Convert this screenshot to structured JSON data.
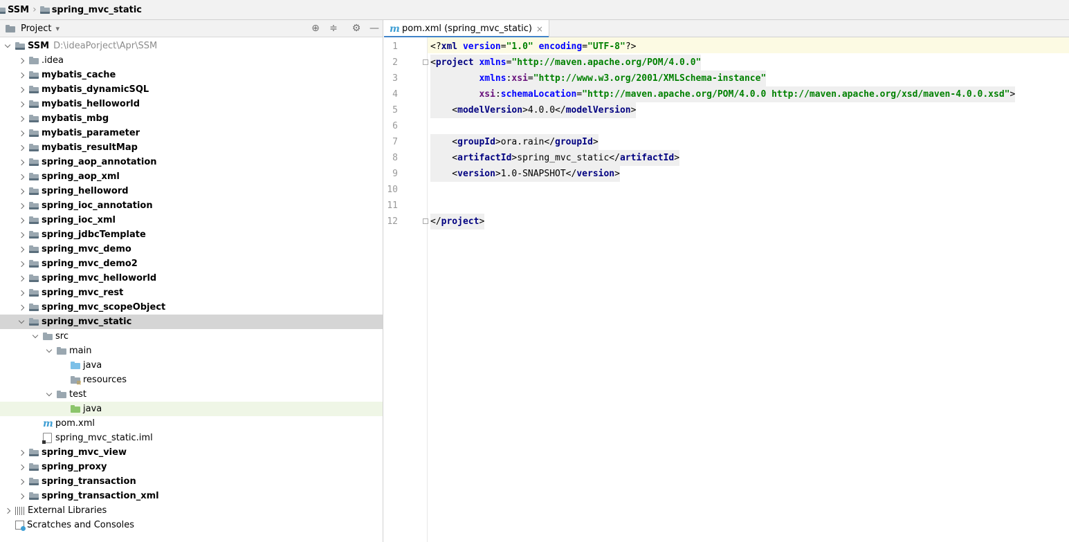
{
  "breadcrumb": {
    "root": "SSM",
    "current": "spring_mvc_static"
  },
  "project_panel": {
    "title": "Project",
    "tree": [
      {
        "label": "SSM",
        "hint": "D:\\ideaPorject\\Apr\\SSM",
        "depth": 0,
        "expanded": true,
        "bold": true,
        "icon": "module-folder-icon"
      },
      {
        "label": ".idea",
        "depth": 1,
        "expanded": false,
        "bold": false,
        "icon": "folder-icon"
      },
      {
        "label": "mybatis_cache",
        "depth": 1,
        "expanded": false,
        "bold": true,
        "icon": "module-folder-icon"
      },
      {
        "label": "mybatis_dynamicSQL",
        "depth": 1,
        "expanded": false,
        "bold": true,
        "icon": "module-folder-icon"
      },
      {
        "label": "mybatis_helloworld",
        "depth": 1,
        "expanded": false,
        "bold": true,
        "icon": "module-folder-icon"
      },
      {
        "label": "mybatis_mbg",
        "depth": 1,
        "expanded": false,
        "bold": true,
        "icon": "module-folder-icon"
      },
      {
        "label": "mybatis_parameter",
        "depth": 1,
        "expanded": false,
        "bold": true,
        "icon": "module-folder-icon"
      },
      {
        "label": "mybatis_resultMap",
        "depth": 1,
        "expanded": false,
        "bold": true,
        "icon": "module-folder-icon"
      },
      {
        "label": "spring_aop_annotation",
        "depth": 1,
        "expanded": false,
        "bold": true,
        "icon": "module-folder-icon"
      },
      {
        "label": "spring_aop_xml",
        "depth": 1,
        "expanded": false,
        "bold": true,
        "icon": "module-folder-icon"
      },
      {
        "label": "spring_helloword",
        "depth": 1,
        "expanded": false,
        "bold": true,
        "icon": "module-folder-icon"
      },
      {
        "label": "spring_ioc_annotation",
        "depth": 1,
        "expanded": false,
        "bold": true,
        "icon": "module-folder-icon"
      },
      {
        "label": "spring_ioc_xml",
        "depth": 1,
        "expanded": false,
        "bold": true,
        "icon": "module-folder-icon"
      },
      {
        "label": "spring_jdbcTemplate",
        "depth": 1,
        "expanded": false,
        "bold": true,
        "icon": "module-folder-icon"
      },
      {
        "label": "spring_mvc_demo",
        "depth": 1,
        "expanded": false,
        "bold": true,
        "icon": "module-folder-icon"
      },
      {
        "label": "spring_mvc_demo2",
        "depth": 1,
        "expanded": false,
        "bold": true,
        "icon": "module-folder-icon"
      },
      {
        "label": "spring_mvc_helloworld",
        "depth": 1,
        "expanded": false,
        "bold": true,
        "icon": "module-folder-icon"
      },
      {
        "label": "spring_mvc_rest",
        "depth": 1,
        "expanded": false,
        "bold": true,
        "icon": "module-folder-icon"
      },
      {
        "label": "spring_mvc_scopeObject",
        "depth": 1,
        "expanded": false,
        "bold": true,
        "icon": "module-folder-icon"
      },
      {
        "label": "spring_mvc_static",
        "depth": 1,
        "expanded": true,
        "bold": true,
        "icon": "module-folder-icon",
        "selected": true
      },
      {
        "label": "src",
        "depth": 2,
        "expanded": true,
        "bold": false,
        "icon": "folder-icon"
      },
      {
        "label": "main",
        "depth": 3,
        "expanded": true,
        "bold": false,
        "icon": "folder-icon"
      },
      {
        "label": "java",
        "depth": 4,
        "leaf": true,
        "bold": false,
        "icon": "source-folder-icon"
      },
      {
        "label": "resources",
        "depth": 4,
        "leaf": true,
        "bold": false,
        "icon": "resources-folder-icon"
      },
      {
        "label": "test",
        "depth": 3,
        "expanded": true,
        "bold": false,
        "icon": "folder-icon"
      },
      {
        "label": "java",
        "depth": 4,
        "leaf": true,
        "bold": false,
        "icon": "test-folder-icon",
        "hover": true
      },
      {
        "label": "pom.xml",
        "depth": 2,
        "leaf": true,
        "bold": false,
        "icon": "maven-icon"
      },
      {
        "label": "spring_mvc_static.iml",
        "depth": 2,
        "leaf": true,
        "bold": false,
        "icon": "iml-file-icon"
      },
      {
        "label": "spring_mvc_view",
        "depth": 1,
        "expanded": false,
        "bold": true,
        "icon": "module-folder-icon"
      },
      {
        "label": "spring_proxy",
        "depth": 1,
        "expanded": false,
        "bold": true,
        "icon": "module-folder-icon"
      },
      {
        "label": "spring_transaction",
        "depth": 1,
        "expanded": false,
        "bold": true,
        "icon": "module-folder-icon"
      },
      {
        "label": "spring_transaction_xml",
        "depth": 1,
        "expanded": false,
        "bold": true,
        "icon": "module-folder-icon"
      },
      {
        "label": "External Libraries",
        "depth": 0,
        "expanded": false,
        "bold": false,
        "icon": "libraries-icon"
      },
      {
        "label": "Scratches and Consoles",
        "depth": 0,
        "leaf": true,
        "bold": false,
        "icon": "scratches-icon"
      }
    ]
  },
  "editor": {
    "tab_label": "pom.xml (spring_mvc_static)",
    "lines": [
      [
        [
          "t-txt",
          "<?"
        ],
        [
          "t-tag",
          "xml"
        ],
        [
          "t-txt",
          " "
        ],
        [
          "t-attr",
          "version"
        ],
        [
          "t-txt",
          "="
        ],
        [
          "t-val",
          "\"1.0\""
        ],
        [
          "t-txt",
          " "
        ],
        [
          "t-attr",
          "encoding"
        ],
        [
          "t-txt",
          "="
        ],
        [
          "t-val",
          "\"UTF-8\""
        ],
        [
          "t-txt",
          "?>"
        ]
      ],
      [
        [
          "t-txt",
          "<"
        ],
        [
          "t-tag",
          "project"
        ],
        [
          "t-txt",
          " "
        ],
        [
          "t-attr",
          "xmlns"
        ],
        [
          "t-txt",
          "="
        ],
        [
          "t-val",
          "\"http://maven.apache.org/POM/4.0.0\""
        ]
      ],
      [
        [
          "t-txt",
          "         "
        ],
        [
          "t-attr",
          "xmlns"
        ],
        [
          "t-txt",
          ":"
        ],
        [
          "t-ns",
          "xsi"
        ],
        [
          "t-txt",
          "="
        ],
        [
          "t-val",
          "\"http://www.w3.org/2001/XMLSchema-instance\""
        ]
      ],
      [
        [
          "t-txt",
          "         "
        ],
        [
          "t-ns",
          "xsi"
        ],
        [
          "t-txt",
          ":"
        ],
        [
          "t-attr",
          "schemaLocation"
        ],
        [
          "t-txt",
          "="
        ],
        [
          "t-val",
          "\"http://maven.apache.org/POM/4.0.0 http://maven.apache.org/xsd/maven-4.0.0.xsd\""
        ],
        [
          "t-txt",
          ">"
        ]
      ],
      [
        [
          "t-txt",
          "    <"
        ],
        [
          "t-tag",
          "modelVersion"
        ],
        [
          "t-txt",
          ">4.0.0</"
        ],
        [
          "t-tag",
          "modelVersion"
        ],
        [
          "t-txt",
          ">"
        ]
      ],
      [],
      [
        [
          "t-txt",
          "    <"
        ],
        [
          "t-tag",
          "groupId"
        ],
        [
          "t-txt",
          ">ora.rain</"
        ],
        [
          "t-tag",
          "groupId"
        ],
        [
          "t-txt",
          ">"
        ]
      ],
      [
        [
          "t-txt",
          "    <"
        ],
        [
          "t-tag",
          "artifactId"
        ],
        [
          "t-txt",
          ">spring_mvc_static</"
        ],
        [
          "t-tag",
          "artifactId"
        ],
        [
          "t-txt",
          ">"
        ]
      ],
      [
        [
          "t-txt",
          "    <"
        ],
        [
          "t-tag",
          "version"
        ],
        [
          "t-txt",
          ">1.0-SNAPSHOT</"
        ],
        [
          "t-tag",
          "version"
        ],
        [
          "t-txt",
          ">"
        ]
      ],
      [],
      [],
      [
        [
          "t-txt",
          "</"
        ],
        [
          "t-tag",
          "project"
        ],
        [
          "t-txt",
          ">"
        ]
      ]
    ]
  },
  "icons": {
    "crosshair": "⊕",
    "collapse": "≑",
    "gear": "⚙",
    "minimize": "—",
    "close": "×",
    "dropdown": "▾"
  },
  "colors": {
    "selection": "#d5d5d5",
    "hover_row": "#eff6e6",
    "caret_line": "#fcfae3",
    "tab_underline": "#4083c9",
    "xml_tag": "#000080",
    "xml_attr": "#0000ff",
    "xml_value": "#008000"
  }
}
